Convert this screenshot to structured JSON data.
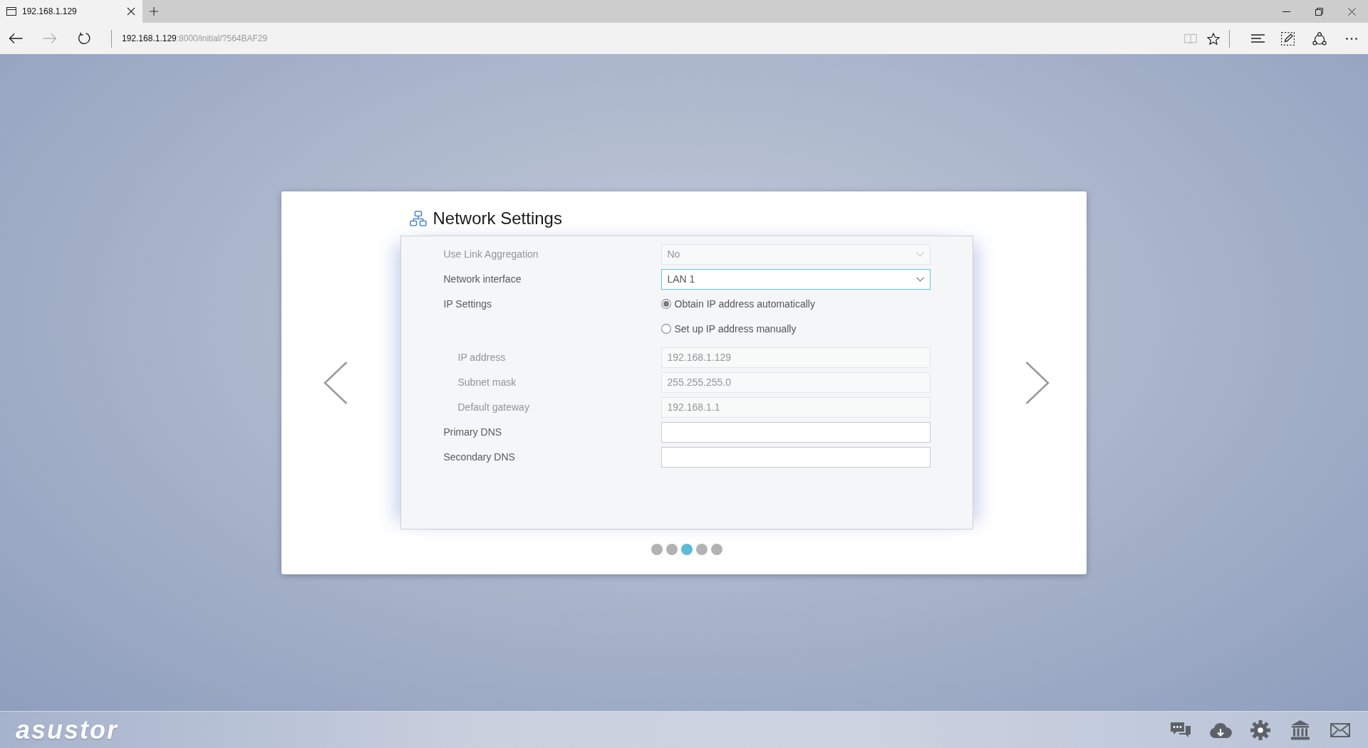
{
  "browser": {
    "tab": {
      "title": "192.168.1.129",
      "selected": true
    },
    "nav_buttons": [
      {
        "kind": "back",
        "disabled": false
      },
      {
        "kind": "forward",
        "disabled": true
      },
      {
        "kind": "refresh",
        "disabled": false
      }
    ],
    "address": {
      "host": "192.168.1.129",
      "rest": ":8000/initial/?564BAF29"
    },
    "toolbar": {
      "left": [
        {
          "kind": "reading-view",
          "disabled": true
        },
        {
          "kind": "favorite",
          "disabled": false
        }
      ],
      "right": [
        {
          "kind": "hub",
          "disabled": false
        },
        {
          "kind": "web-note",
          "disabled": false
        },
        {
          "kind": "share",
          "disabled": false
        },
        {
          "kind": "more",
          "disabled": false
        }
      ]
    }
  },
  "wizard": {
    "title": "Network Settings",
    "fields": [
      {
        "kind": "select",
        "label": "Use Link Aggregation",
        "value": "No",
        "disabled": true,
        "focused": false
      },
      {
        "kind": "select",
        "label": "Network interface",
        "value": "LAN 1",
        "disabled": false,
        "focused": true
      },
      {
        "kind": "radio",
        "label": "IP Settings",
        "options": [
          {
            "label": "Obtain IP address automatically",
            "selected": true
          },
          {
            "label": "Set up IP address manually",
            "selected": false,
            "children": [
              {
                "kind": "text",
                "label": "IP address",
                "value": "192.168.1.129",
                "disabled": true,
                "focused": false
              },
              {
                "kind": "text",
                "label": "Subnet mask",
                "value": "255.255.255.0",
                "disabled": true,
                "focused": false
              },
              {
                "kind": "text",
                "label": "Default gateway",
                "value": "192.168.1.1",
                "disabled": true,
                "focused": false
              }
            ]
          }
        ]
      },
      {
        "kind": "text",
        "label": "Primary DNS",
        "disabled": false,
        "focused": false
      },
      {
        "kind": "text",
        "label": "Secondary DNS",
        "disabled": false,
        "focused": false
      }
    ],
    "steps": [
      {
        "selected": false
      },
      {
        "selected": false
      },
      {
        "selected": true
      },
      {
        "selected": false
      },
      {
        "selected": false
      }
    ]
  },
  "taskbar": {
    "logo": "asustor",
    "icons": [
      {
        "kind": "chat"
      },
      {
        "kind": "cloud-download"
      },
      {
        "kind": "gear"
      },
      {
        "kind": "bank"
      },
      {
        "kind": "mail"
      }
    ]
  }
}
